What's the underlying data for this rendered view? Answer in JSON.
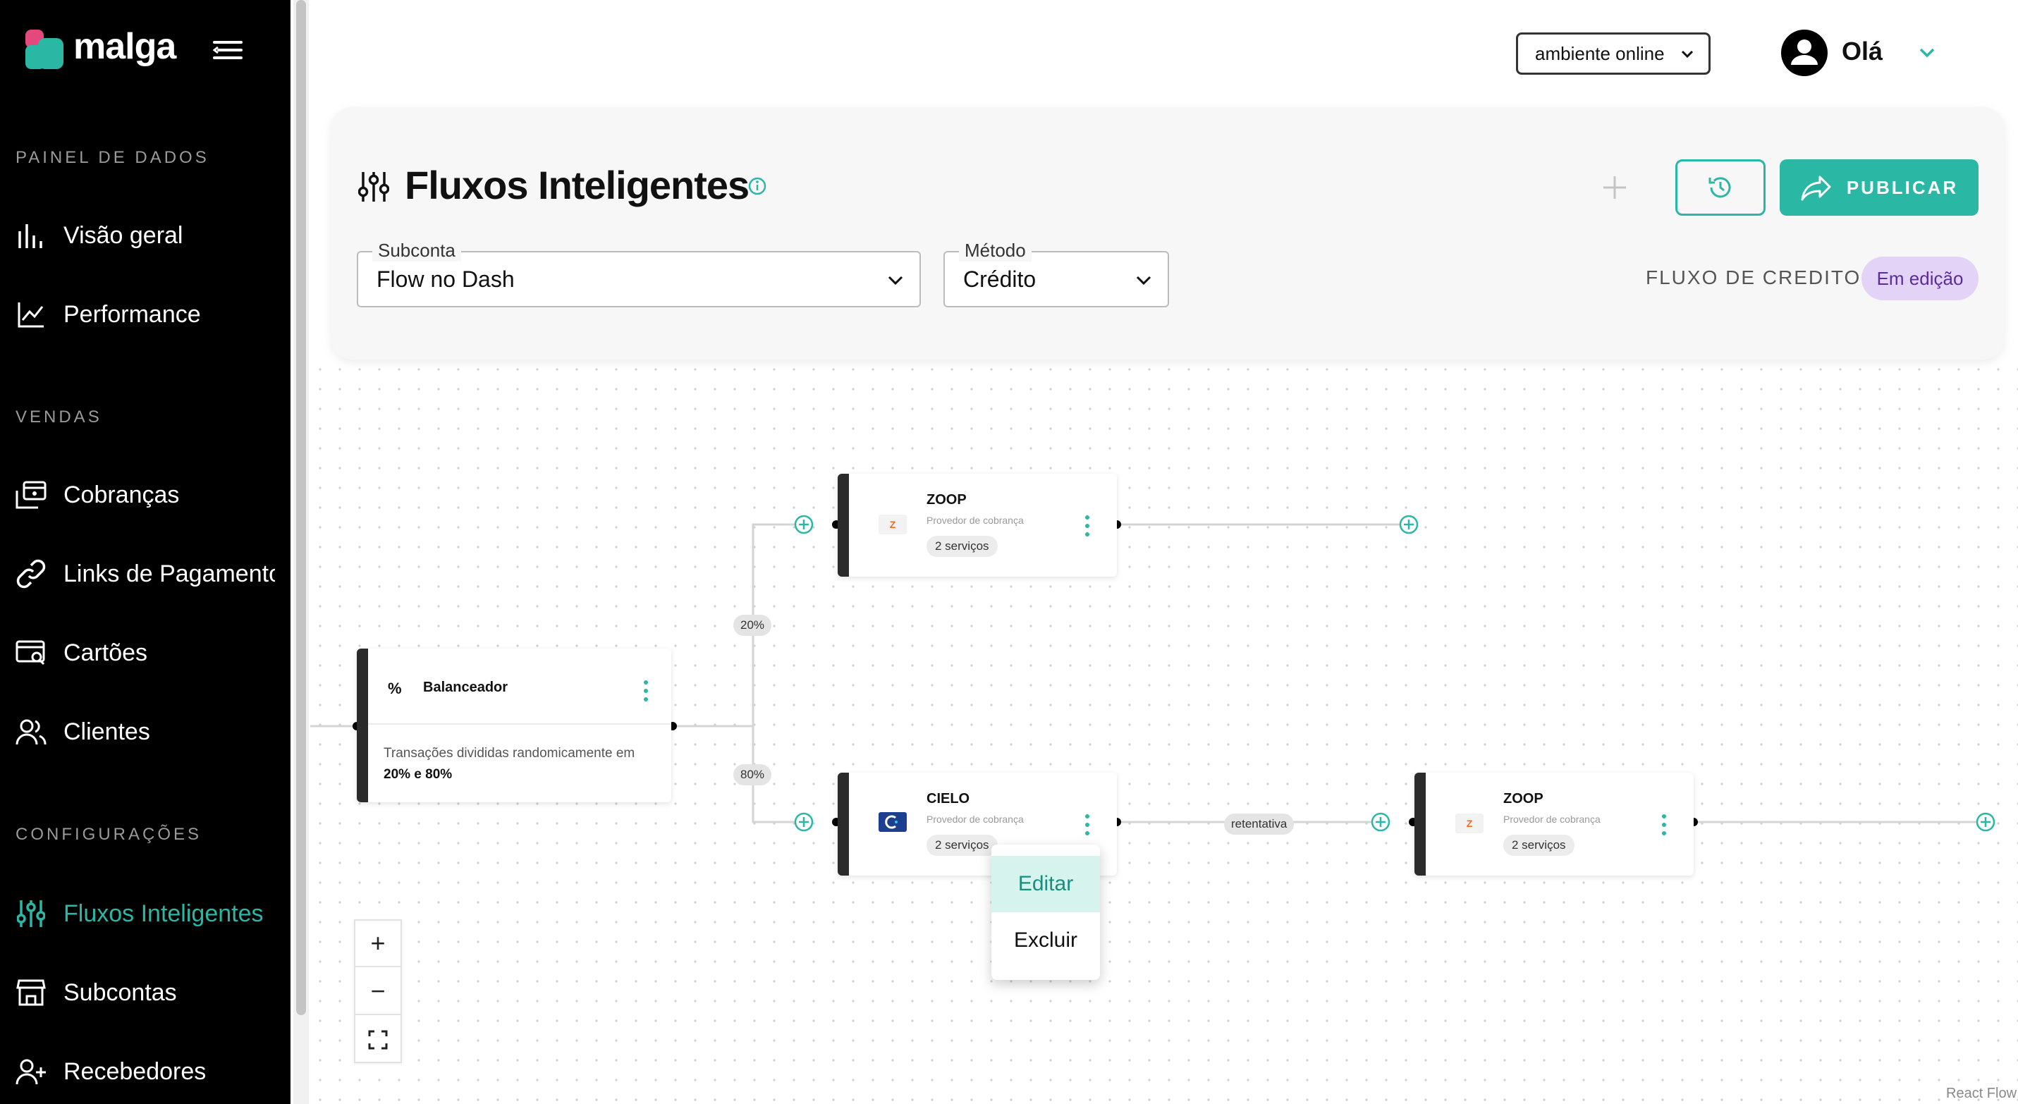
{
  "brand": {
    "name": "malga",
    "accent": "#2ab7a4",
    "logo_colors": [
      "#e4487d",
      "#2ab7a4"
    ]
  },
  "sidebar": {
    "sections": [
      {
        "label": "PAINEL DE DADOS"
      },
      {
        "label": "VENDAS"
      },
      {
        "label": "CONFIGURAÇÕES"
      }
    ],
    "items": [
      {
        "label": "Visão geral",
        "icon": "bar-chart-icon"
      },
      {
        "label": "Performance",
        "icon": "line-chart-icon"
      },
      {
        "label": "Cobranças",
        "icon": "charges-icon"
      },
      {
        "label": "Links de Pagamento",
        "icon": "link-icon"
      },
      {
        "label": "Cartões",
        "icon": "card-search-icon"
      },
      {
        "label": "Clientes",
        "icon": "users-icon"
      },
      {
        "label": "Fluxos Inteligentes",
        "icon": "sliders-icon",
        "active": true
      },
      {
        "label": "Subcontas",
        "icon": "store-icon"
      },
      {
        "label": "Recebedores",
        "icon": "user-plus-icon"
      }
    ]
  },
  "topbar": {
    "environment": "ambiente online",
    "greeting": "Olá"
  },
  "header": {
    "title": "Fluxos Inteligentes",
    "publish_label": "PUBLICAR",
    "subconta": {
      "label": "Subconta",
      "value": "Flow no Dash"
    },
    "metodo": {
      "label": "Método",
      "value": "Crédito"
    },
    "flow_label": "FLUXO DE CREDITO",
    "status_badge": "Em edição"
  },
  "flow": {
    "balancer": {
      "title": "Balanceador",
      "description": "Transações divididas randomicamente em",
      "split": "20% e 80%"
    },
    "branches": [
      "20%",
      "80%"
    ],
    "nodes": [
      {
        "title": "ZOOP",
        "subtitle": "Provedor de cobrança",
        "chip": "2 serviços",
        "logo": "Z"
      },
      {
        "title": "CIELO",
        "subtitle": "Provedor de cobrança",
        "chip": "2 serviços",
        "logo": "cielo"
      },
      {
        "title": "ZOOP",
        "subtitle": "Provedor de cobrança",
        "chip": "2 serviços",
        "logo": "Z"
      }
    ],
    "edge_label": "retentativa"
  },
  "context_menu": {
    "items": [
      "Editar",
      "Excluir"
    ]
  },
  "zoom": {
    "in": "+",
    "out": "−"
  },
  "attribution": "React Flow"
}
